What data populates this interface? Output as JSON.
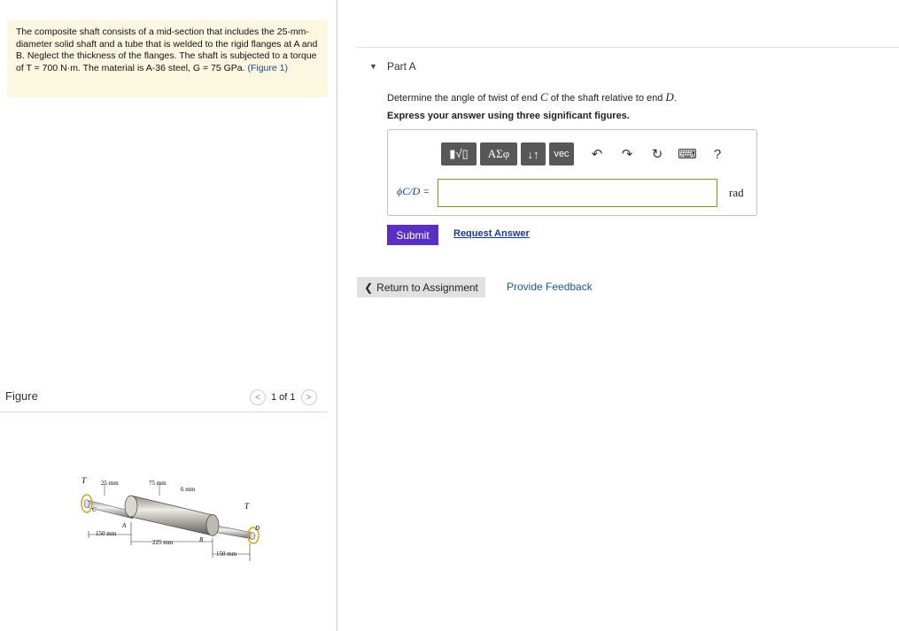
{
  "problem": {
    "text": "The composite shaft consists of a mid-section that includes the 25-mm-diameter solid shaft and a tube that is welded to the rigid flanges at A and B. Neglect the thickness of the flanges. The shaft is subjected to a torque of T = 700 N·m. The material is A-36 steel, G = 75 GPa.",
    "figure_link": "(Figure 1)"
  },
  "figure_panel": {
    "label": "Figure",
    "pager_text": "1 of 1",
    "prev_icon": "chevron-left-icon",
    "next_icon": "chevron-right-icon"
  },
  "figure_labels": {
    "T_left": "T",
    "T_right": "T",
    "dim_25": "25 mm",
    "dim_75": "75 mm",
    "dim_6": "6 mm",
    "C": "C",
    "A": "A",
    "B": "B",
    "D": "D",
    "dim_150_left": "150 mm",
    "dim_225": "225 mm",
    "dim_150_right": "150 mm"
  },
  "part": {
    "title": "Part A",
    "prompt_pre": "Determine the angle of twist of end ",
    "prompt_C": "C",
    "prompt_mid": " of the shaft relative to end ",
    "prompt_D": "D",
    "prompt_end": ".",
    "instruction": "Express your answer using three significant figures."
  },
  "toolbar": {
    "templates_label": "▮√▯",
    "greek_label": "ΑΣφ",
    "sort_label": "↓↑",
    "vec_label": "vec",
    "icons": [
      "undo-icon",
      "redo-icon",
      "reset-icon",
      "keyboard-icon",
      "help-icon"
    ],
    "help_label": "?"
  },
  "answer": {
    "variable_label": "ϕC/D =",
    "value": "",
    "unit": "rad"
  },
  "actions": {
    "submit_label": "Submit",
    "request_label": "Request Answer",
    "return_label": "Return to Assignment",
    "feedback_label": "Provide Feedback"
  },
  "colors": {
    "problem_bg": "#fbf7e1",
    "submit_bg": "#5a2fc4",
    "toolbar_bg": "#585858",
    "link": "#1a3a8a"
  }
}
